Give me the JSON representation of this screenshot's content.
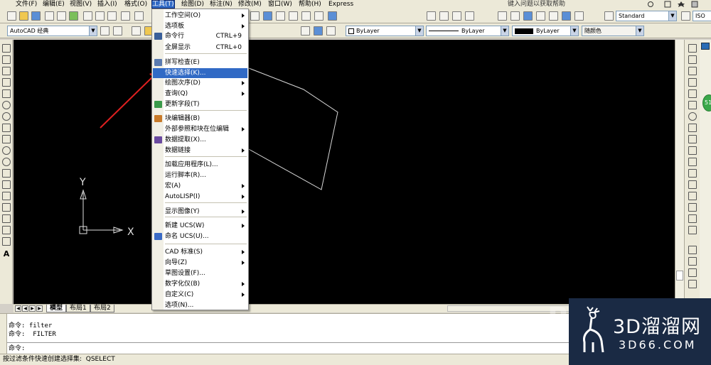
{
  "menubar": {
    "items": [
      "文件(F)",
      "编辑(E)",
      "视图(V)",
      "插入(I)",
      "格式(O)",
      "工具(T)",
      "绘图(D)",
      "标注(N)",
      "修改(M)",
      "窗口(W)",
      "帮助(H)",
      "Express"
    ],
    "help_search": "键入问题以获取帮助"
  },
  "toolbar": {
    "workspace": "AutoCAD 经典",
    "text_style": "Standard",
    "dim_style": "ISO",
    "color": "ByLayer",
    "linetype": "ByLayer",
    "lineweight": "ByLayer",
    "plot_style": "随颜色"
  },
  "tools_menu": {
    "items": [
      {
        "label": "工作空间(O)",
        "shortcut": "",
        "submenu": true,
        "icon": ""
      },
      {
        "label": "选项板",
        "shortcut": "",
        "submenu": true,
        "icon": ""
      },
      {
        "label": "命令行",
        "shortcut": "CTRL+9",
        "submenu": false,
        "icon": "command-line-icon"
      },
      {
        "label": "全屏显示",
        "shortcut": "CTRL+0",
        "submenu": false,
        "icon": ""
      },
      {
        "label": "拼写检查(E)",
        "shortcut": "",
        "submenu": false,
        "icon": "spell-check-icon"
      },
      {
        "label": "快速选择(K)...",
        "shortcut": "",
        "submenu": false,
        "icon": ""
      },
      {
        "label": "绘图次序(D)",
        "shortcut": "",
        "submenu": true,
        "icon": ""
      },
      {
        "label": "查询(Q)",
        "shortcut": "",
        "submenu": true,
        "icon": ""
      },
      {
        "label": "更新字段(T)",
        "shortcut": "",
        "submenu": false,
        "icon": "update-field-icon"
      },
      {
        "label": "块编辑器(B)",
        "shortcut": "",
        "submenu": false,
        "icon": "block-editor-icon"
      },
      {
        "label": "外部参照和块在位编辑",
        "shortcut": "",
        "submenu": true,
        "icon": ""
      },
      {
        "label": "数据提取(X)...",
        "shortcut": "",
        "submenu": false,
        "icon": "data-extraction-icon"
      },
      {
        "label": "数据链接",
        "shortcut": "",
        "submenu": true,
        "icon": ""
      },
      {
        "label": "加载应用程序(L)...",
        "shortcut": "",
        "submenu": false,
        "icon": ""
      },
      {
        "label": "运行脚本(R)...",
        "shortcut": "",
        "submenu": false,
        "icon": ""
      },
      {
        "label": "宏(A)",
        "shortcut": "",
        "submenu": true,
        "icon": ""
      },
      {
        "label": "AutoLISP(I)",
        "shortcut": "",
        "submenu": true,
        "icon": ""
      },
      {
        "label": "显示图像(Y)",
        "shortcut": "",
        "submenu": true,
        "icon": ""
      },
      {
        "label": "新建 UCS(W)",
        "shortcut": "",
        "submenu": true,
        "icon": ""
      },
      {
        "label": "命名 UCS(U)...",
        "shortcut": "",
        "submenu": false,
        "icon": "named-ucs-icon"
      },
      {
        "label": "CAD 标准(S)",
        "shortcut": "",
        "submenu": true,
        "icon": ""
      },
      {
        "label": "向导(Z)",
        "shortcut": "",
        "submenu": true,
        "icon": ""
      },
      {
        "label": "草图设置(F)...",
        "shortcut": "",
        "submenu": false,
        "icon": ""
      },
      {
        "label": "数字化仪(B)",
        "shortcut": "",
        "submenu": true,
        "icon": ""
      },
      {
        "label": "自定义(C)",
        "shortcut": "",
        "submenu": true,
        "icon": ""
      },
      {
        "label": "选项(N)...",
        "shortcut": "",
        "submenu": false,
        "icon": ""
      }
    ],
    "highlighted_index": 5
  },
  "canvas": {
    "ucs_x": "X",
    "ucs_y": "Y"
  },
  "layout_tabs": [
    "模型",
    "布局1",
    "布局2"
  ],
  "command": {
    "lines": [
      "命令: filter",
      "命令:  FILTER"
    ],
    "prompt": "命令:"
  },
  "status_text": "按过滤条件快速创建选择集:  QSELECT",
  "watermark": {
    "brand": "3D溜溜网",
    "domain": "3D66.COM",
    "corner": "B"
  },
  "bubble_text": "51",
  "colors": {
    "menu_highlight": "#316ac5",
    "canvas_bg": "#000000",
    "arrow": "#e02020",
    "watermark_bg": "#1a2a44"
  }
}
